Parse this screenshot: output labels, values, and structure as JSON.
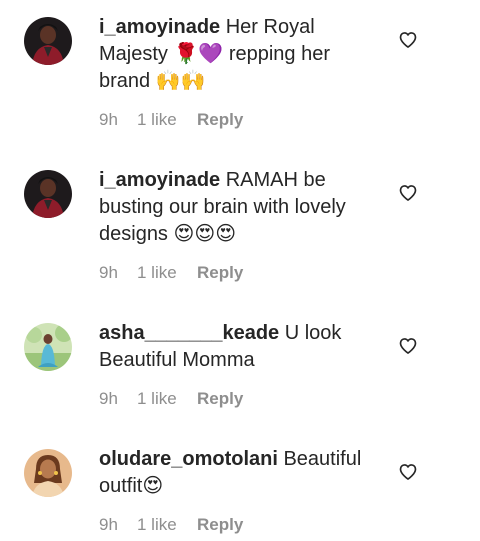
{
  "comments": [
    {
      "username": "i_amoyinade",
      "text": " Her Royal Majesty 🌹💜 repping her brand 🙌🙌",
      "time": "9h",
      "likes": "1 like",
      "reply_label": "Reply",
      "avatar_icon": "profile-photo-red-outfit"
    },
    {
      "username": "i_amoyinade",
      "text": " RAMAH be busting our brain with lovely designs 😍😍😍",
      "time": "9h",
      "likes": "1 like",
      "reply_label": "Reply",
      "avatar_icon": "profile-photo-red-outfit"
    },
    {
      "username": "asha_______keade",
      "text": " U look Beautiful Momma",
      "time": "9h",
      "likes": "1 like",
      "reply_label": "Reply",
      "avatar_icon": "profile-photo-outdoor"
    },
    {
      "username": "oludare_omotolani",
      "text": " Beautiful outfit😍",
      "time": "9h",
      "likes": "1 like",
      "reply_label": "Reply",
      "avatar_icon": "profile-photo-woman"
    }
  ],
  "colors": {
    "text": "#262626",
    "meta": "#8e8e8e",
    "icon": "#262626"
  },
  "icons": {
    "like": "heart-outline-icon"
  }
}
